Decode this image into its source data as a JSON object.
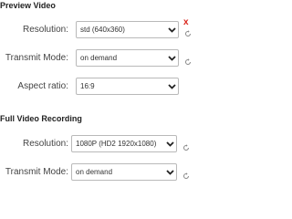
{
  "preview": {
    "title": "Preview Video",
    "resolution": {
      "label": "Resolution:",
      "value": "std (640x360)"
    },
    "transmit_mode": {
      "label": "Transmit Mode:",
      "value": "on demand"
    },
    "aspect_ratio": {
      "label": "Aspect ratio:",
      "value": "16:9"
    },
    "clear_glyph": "x"
  },
  "full_recording": {
    "title": "Full Video Recording",
    "resolution": {
      "label": "Resolution:",
      "value": "1080P (HD2 1920x1080)"
    },
    "transmit_mode": {
      "label": "Transmit Mode:",
      "value": "on demand"
    }
  },
  "colors": {
    "clear_red": "#d9261c",
    "border": "#b9b9b9",
    "reset_grey": "#888888"
  },
  "icons": {
    "dropdown": "chevron-down-icon",
    "reset": "reset-icon",
    "clear": "close-icon"
  }
}
